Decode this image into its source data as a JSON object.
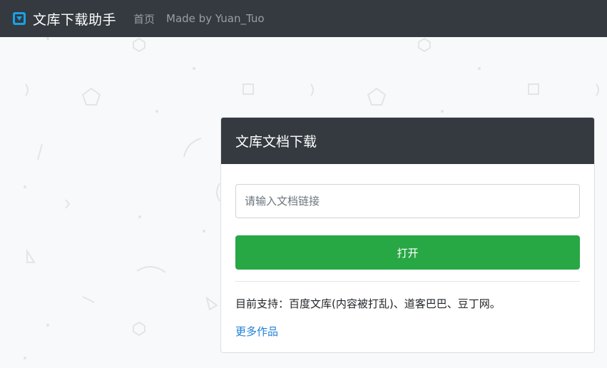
{
  "navbar": {
    "brand": "文库下载助手",
    "links": [
      "首页"
    ],
    "credit": "Made by Yuan_Tuo"
  },
  "card": {
    "title": "文库文档下载",
    "input_placeholder": "请输入文档链接",
    "input_value": "",
    "open_button": "打开",
    "support_text": "目前支持：百度文库(内容被打乱)、道客巴巴、豆丁网。",
    "more_link": "更多作品"
  },
  "colors": {
    "navbar_bg": "#343a40",
    "button_green": "#28a745",
    "link_blue": "#1f7fd6",
    "page_bg": "#f8f9fa"
  },
  "icons": {
    "brand": "download-box-icon"
  }
}
